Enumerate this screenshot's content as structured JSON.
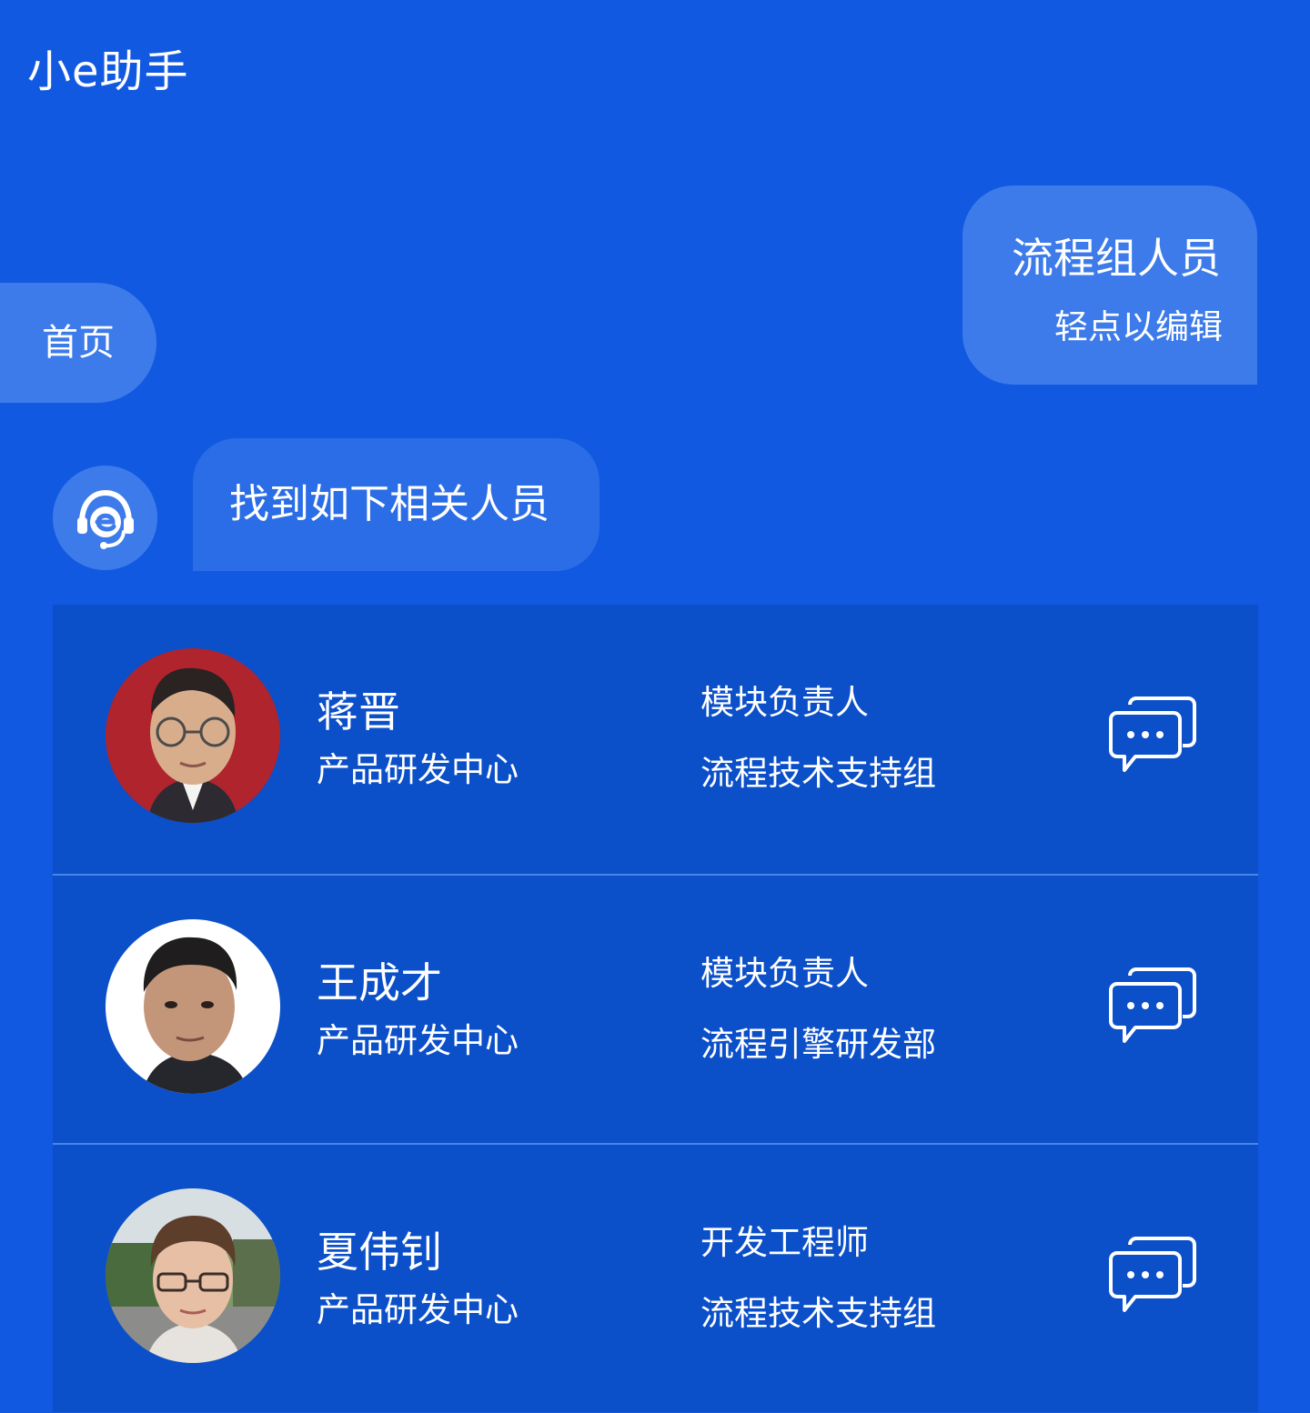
{
  "app": {
    "title": "小e助手"
  },
  "conversation": {
    "user_query": "流程组人员",
    "edit_hint": "轻点以编辑",
    "home_label": "首页",
    "bot_reply": "找到如下相关人员"
  },
  "results": [
    {
      "name": "蒋晋",
      "department": "产品研发中心",
      "role": "模块负责人",
      "group": "流程技术支持组",
      "avatar_bg": "#b0242e"
    },
    {
      "name": "王成才",
      "department": "产品研发中心",
      "role": "模块负责人",
      "group": "流程引擎研发部",
      "avatar_bg": "#ffffff"
    },
    {
      "name": "夏伟钊",
      "department": "产品研发中心",
      "role": "开发工程师",
      "group": "流程技术支持组",
      "avatar_bg": "#7f9a6a"
    }
  ],
  "icons": {
    "bot_avatar": "headset-e-icon",
    "chat": "chat-bubbles-icon"
  },
  "colors": {
    "background": "#1259e2",
    "user_bubble": "#3d7beb",
    "bot_bubble": "#2b6de6",
    "result_list": "#0b4fc9",
    "divider": "#4a86ea"
  }
}
